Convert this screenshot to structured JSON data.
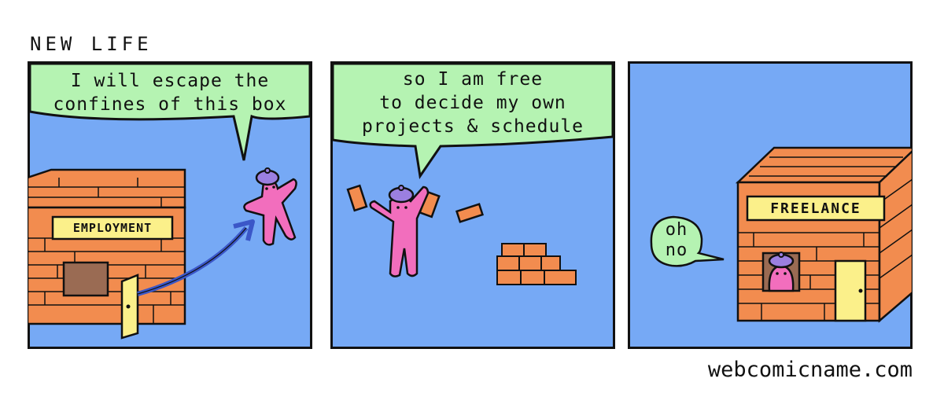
{
  "comic": {
    "title": "NEW LIFE",
    "credit": "webcomicname.com",
    "panels": [
      {
        "speech": "I will escape the\nconfines of this box",
        "sign": "EMPLOYMENT"
      },
      {
        "speech": "so I am free\nto decide my own\nprojects & schedule"
      },
      {
        "speech": "oh\nno",
        "sign": "FREELANCE"
      }
    ]
  },
  "colors": {
    "sky": "#76a9f5",
    "bubble": "#b5f3b2",
    "brick": "#f28c4f",
    "sign": "#fbf08a",
    "character": "#f26ebd",
    "hat": "#9b7fe0",
    "arrow": "#3b57c8"
  }
}
